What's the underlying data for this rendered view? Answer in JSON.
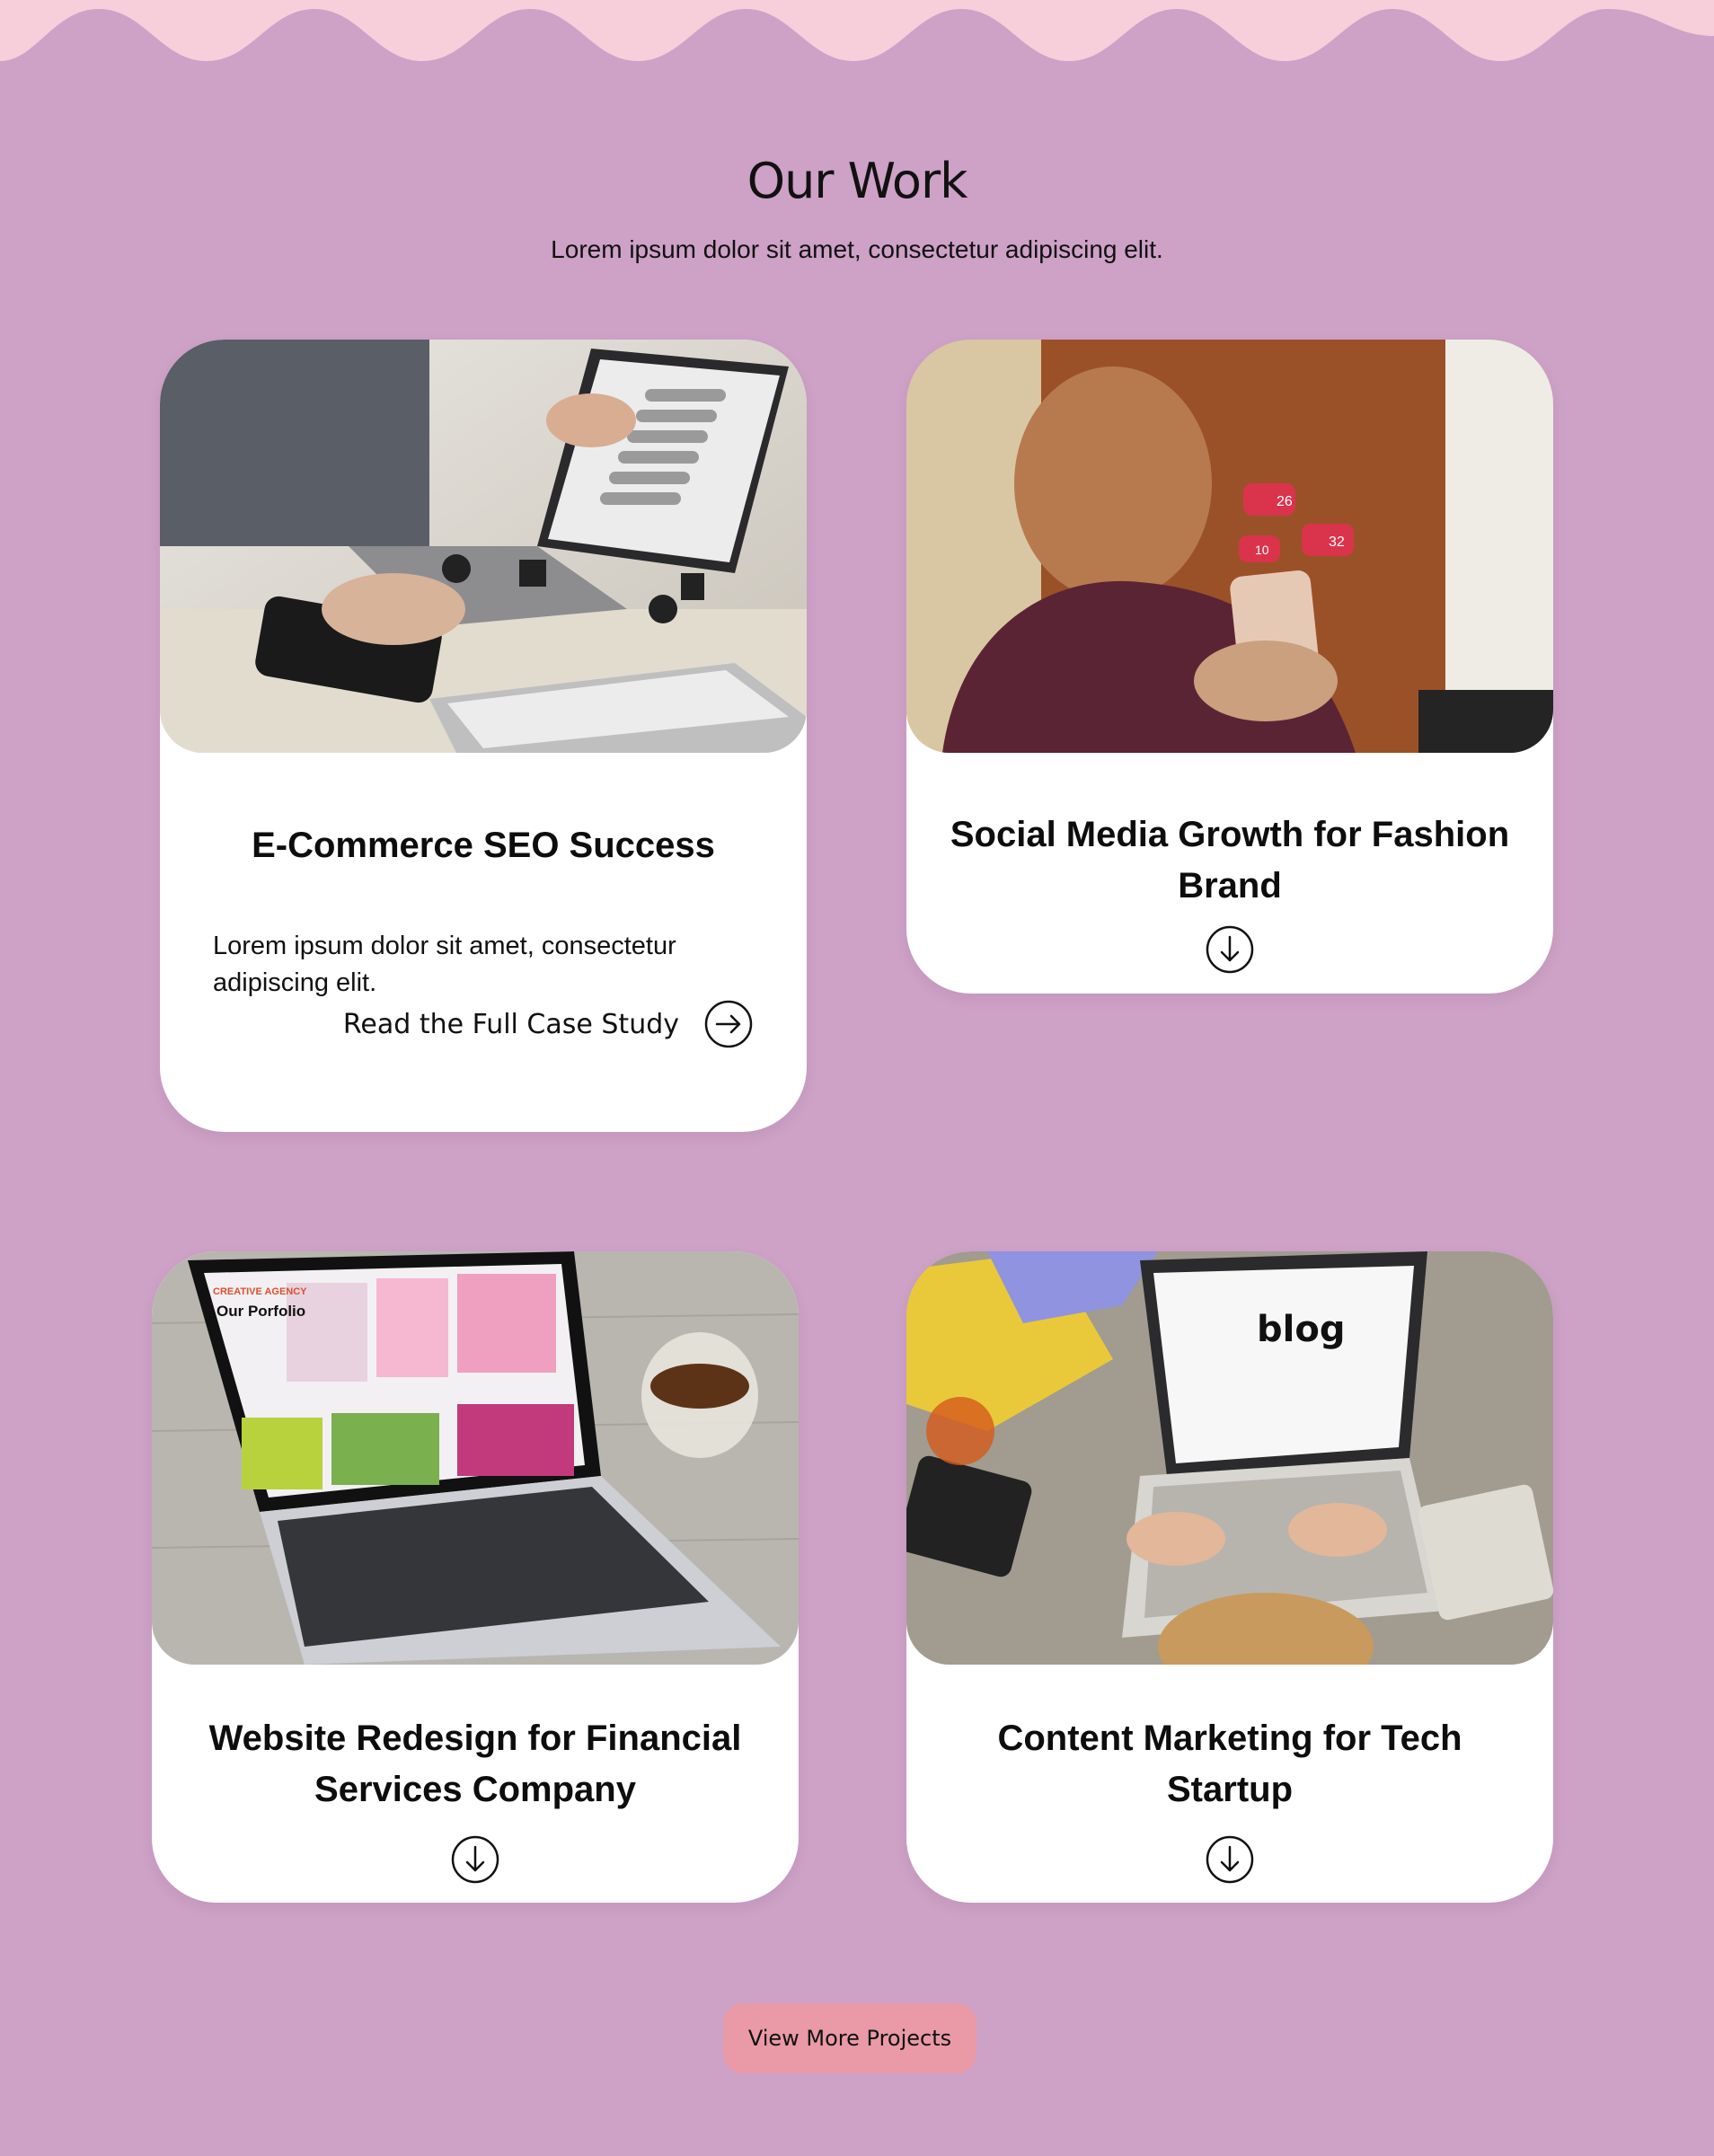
{
  "section": {
    "title": "Our Work",
    "subtitle": "Lorem ipsum dolor sit amet, consectetur adipiscing elit."
  },
  "cards": [
    {
      "title": "E-Commerce SEO Success",
      "description": "Lorem ipsum dolor sit amet, consectetur adipiscing elit.",
      "cta_label": "Read the Full Case Study",
      "image_alt": "seo-laptop-photo",
      "icon": "arrow-right-circle-icon"
    },
    {
      "title": "Social Media Growth for Fashion Brand",
      "image_alt": "social-media-phone-photo",
      "icon": "arrow-down-circle-icon",
      "image_badges": [
        "26",
        "10",
        "32"
      ]
    },
    {
      "title": "Website Redesign for Financial Services Company",
      "image_alt": "portfolio-laptop-photo",
      "icon": "arrow-down-circle-icon",
      "image_text": [
        "CREATIVE AGENCY",
        "Our Porfolio"
      ]
    },
    {
      "title": "Content Marketing for Tech Startup",
      "image_alt": "blog-laptop-photo",
      "icon": "arrow-down-circle-icon",
      "image_text": [
        "blog"
      ]
    }
  ],
  "more_button": {
    "label": "View More Projects"
  },
  "colors": {
    "background": "#cea1c7",
    "wave": "#f6cfda",
    "card": "#ffffff",
    "button": "#e99aa6"
  }
}
